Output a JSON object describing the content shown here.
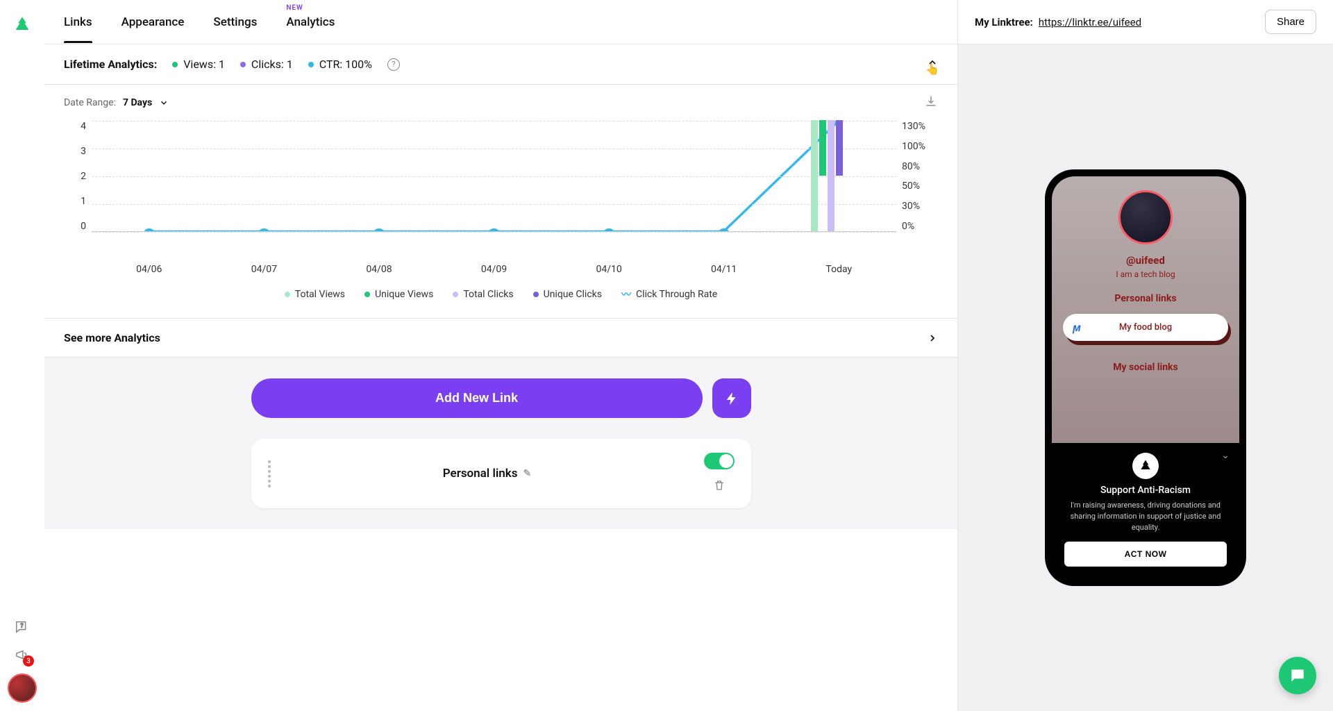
{
  "tabs": {
    "links": "Links",
    "appearance": "Appearance",
    "settings": "Settings",
    "analytics": "Analytics",
    "new_badge": "NEW"
  },
  "lifetime": {
    "label": "Lifetime Analytics:",
    "views": "Views: 1",
    "clicks": "Clicks: 1",
    "ctr": "CTR: 100%"
  },
  "date_range": {
    "label": "Date Range:",
    "value": "7 Days"
  },
  "legend": {
    "total_views": "Total Views",
    "unique_views": "Unique Views",
    "total_clicks": "Total Clicks",
    "unique_clicks": "Unique Clicks",
    "ctr": "Click Through Rate"
  },
  "see_more": "See more Analytics",
  "add_link": "Add New Link",
  "link_card": {
    "title": "Personal links"
  },
  "right_header": {
    "label": "My Linktree:",
    "url": "https://linktr.ee/uifeed",
    "share": "Share"
  },
  "preview": {
    "handle": "@uifeed",
    "bio": "I am a tech blog",
    "section1": "Personal links",
    "link1": "My food blog",
    "section2": "My social links",
    "banner_title": "Support Anti-Racism",
    "banner_desc": "I'm raising awareness, driving donations and sharing information in support of justice and equality.",
    "banner_cta": "ACT NOW"
  },
  "rail": {
    "badge": "3"
  },
  "colors": {
    "green": "#1ec773",
    "purpleDot": "#8b6cf0",
    "blue": "#30b7f0",
    "lightGreen": "#a9e8c5",
    "lightPurple": "#cdbdf7",
    "darkPurple": "#7b61d6"
  },
  "chart_data": {
    "type": "combo",
    "x": [
      "04/06",
      "04/07",
      "04/08",
      "04/09",
      "04/10",
      "04/11",
      "Today"
    ],
    "y_left_ticks": [
      4,
      3,
      2,
      1,
      0
    ],
    "y_right_ticks": [
      "130%",
      "100%",
      "80%",
      "50%",
      "30%",
      "0%"
    ],
    "series": [
      {
        "name": "Total Views",
        "type": "bar",
        "color": "#a9e8c5",
        "values": [
          0,
          0,
          0,
          0,
          0,
          0,
          4
        ]
      },
      {
        "name": "Unique Views",
        "type": "bar",
        "color": "#1ec773",
        "values": [
          0,
          0,
          0,
          0,
          0,
          0,
          2
        ]
      },
      {
        "name": "Total Clicks",
        "type": "bar",
        "color": "#cdbdf7",
        "values": [
          0,
          0,
          0,
          0,
          0,
          0,
          4
        ]
      },
      {
        "name": "Unique Clicks",
        "type": "bar",
        "color": "#7b61d6",
        "values": [
          0,
          0,
          0,
          0,
          0,
          0,
          2
        ]
      },
      {
        "name": "Click Through Rate",
        "type": "line",
        "color": "#30b7f0",
        "values": [
          0,
          0,
          0,
          0,
          0,
          0,
          130
        ]
      }
    ],
    "y_left_max": 4,
    "y_right_max": 130
  }
}
